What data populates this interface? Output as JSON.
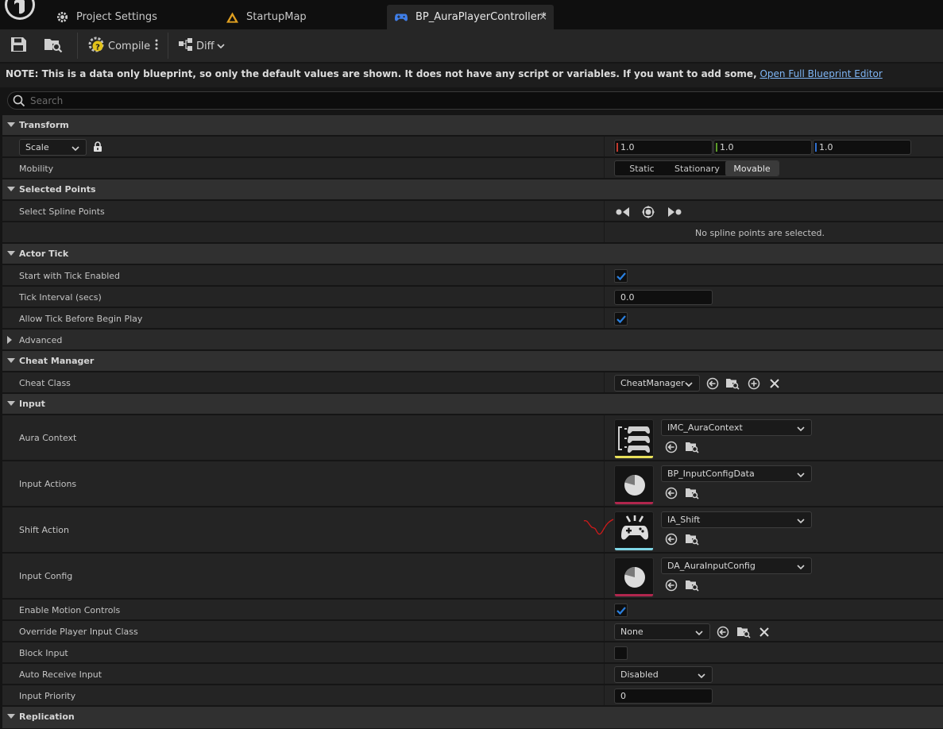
{
  "tabs": [
    {
      "label": "Project Settings",
      "icon": "gear-icon"
    },
    {
      "label": "StartupMap",
      "icon": "level-map-icon"
    },
    {
      "label": "BP_AuraPlayerController*",
      "icon": "gamepad-icon",
      "close": "×"
    }
  ],
  "toolbar": {
    "compile_label": "Compile",
    "diff_label": "Diff"
  },
  "notice": {
    "bold": "NOTE: This is a data only blueprint, so only the default values are shown.",
    "text": "  It does not have any script or variables.  If you want to add some,",
    "link": "Open Full Blueprint Editor"
  },
  "search": {
    "placeholder": "Search"
  },
  "transform": {
    "category": "Transform",
    "scale_mode": "Scale",
    "scale": [
      "1.0",
      "1.0",
      "1.0"
    ],
    "mobility_label": "Mobility",
    "mobility_options": [
      "Static",
      "Stationary",
      "Movable"
    ],
    "mobility_selected": "Movable"
  },
  "selected_points": {
    "category": "Selected Points",
    "select_label": "Select Spline Points",
    "empty_text": "No spline points are selected."
  },
  "actor_tick": {
    "category": "Actor Tick",
    "start_label": "Start with Tick Enabled",
    "start_checked": true,
    "interval_label": "Tick Interval (secs)",
    "interval_value": "0.0",
    "allow_label": "Allow Tick Before Begin Play",
    "allow_checked": true,
    "advanced_label": "Advanced"
  },
  "cheat": {
    "category": "Cheat Manager",
    "class_label": "Cheat Class",
    "class_value": "CheatManager"
  },
  "input": {
    "category": "Input",
    "assets": [
      {
        "label": "Aura Context",
        "value": "IMC_AuraContext",
        "bar_color": "#e8e05a"
      },
      {
        "label": "Input Actions",
        "value": "BP_InputConfigData",
        "bar_color": "#b0264d"
      },
      {
        "label": "Shift Action",
        "value": "IA_Shift",
        "bar_color": "#7fd6e6"
      },
      {
        "label": "Input Config",
        "value": "DA_AuraInputConfig",
        "bar_color": "#b0264d"
      }
    ],
    "motion_label": "Enable Motion Controls",
    "motion_checked": true,
    "override_label": "Override Player Input Class",
    "override_value": "None",
    "block_label": "Block Input",
    "block_checked": false,
    "auto_label": "Auto Receive Input",
    "auto_value": "Disabled",
    "priority_label": "Input Priority",
    "priority_value": "0"
  },
  "replication": {
    "category": "Replication"
  },
  "colors": {
    "accent_blue": "#2a80e0",
    "link": "#7fb6f5",
    "x_axis": "#c23a2e",
    "y_axis": "#5c9c28",
    "z_axis": "#2f6fcf"
  }
}
